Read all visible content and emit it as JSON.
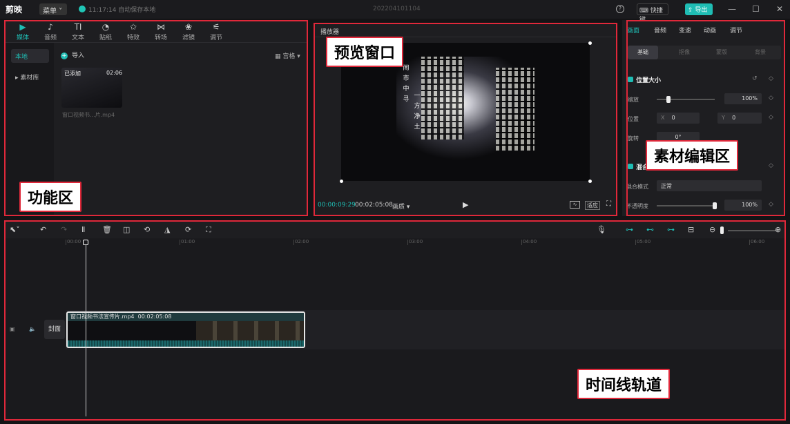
{
  "titlebar": {
    "logo": "剪映",
    "menu": "菜单",
    "save_status": "11:17:14 自动保存本地",
    "project_title": "202204101104",
    "shortcut": "快捷键",
    "export": "导出",
    "minimize": "—",
    "maximize": "☐",
    "close": "✕"
  },
  "left_panel": {
    "tools": [
      {
        "label": "媒体",
        "icon": "▶"
      },
      {
        "label": "音频",
        "icon": "♪"
      },
      {
        "label": "文本",
        "icon": "TI"
      },
      {
        "label": "贴纸",
        "icon": "◔"
      },
      {
        "label": "特效",
        "icon": "✩"
      },
      {
        "label": "转场",
        "icon": "⋈"
      },
      {
        "label": "滤镜",
        "icon": "❀"
      },
      {
        "label": "调节",
        "icon": "⚟"
      }
    ],
    "side": [
      "本地",
      "素材库"
    ],
    "import": "导入",
    "sort": "宫格",
    "media": {
      "added": "已添加",
      "duration": "02:06",
      "name": "窗口视频书...片.mp4"
    },
    "callout": "功能区"
  },
  "player": {
    "title": "播放器",
    "current_time": "00:00:09:29",
    "total_time": "00:02:05:08",
    "quality": "画质",
    "fit": "适应",
    "callout": "预览窗口",
    "video_text": [
      "闹",
      "市",
      "中",
      "寻",
      "一",
      "方",
      "净",
      "土"
    ]
  },
  "right_panel": {
    "tabs": [
      "画面",
      "音频",
      "变速",
      "动画",
      "调节"
    ],
    "sub_tabs": [
      "基础",
      "抠像",
      "蒙版",
      "背景"
    ],
    "section_position": "位置大小",
    "scale_label": "缩放",
    "scale_value": "100%",
    "position_label": "位置",
    "pos_x_label": "X",
    "pos_x": "0",
    "pos_y_label": "Y",
    "pos_y": "0",
    "rotate_label": "旋转",
    "rotate_value": "0°",
    "section_blend": "混合",
    "blend_mode_label": "混合模式",
    "blend_mode_value": "正常",
    "opacity_label": "不透明度",
    "opacity_value": "100%",
    "scale_fraction": 0.2,
    "opacity_fraction": 1.0,
    "callout": "素材编辑区"
  },
  "timeline": {
    "ruler": [
      "00:00",
      "01:00",
      "02:00",
      "03:00",
      "04:00",
      "05:00",
      "06:00"
    ],
    "cover": "封面",
    "clip_label": "窗口视频书法宣传片.mp4",
    "clip_duration": "00:02:05:08",
    "callout": "时间线轨道"
  },
  "colors": {
    "accent": "#1fbdb4",
    "annotation": "#e0283a"
  }
}
